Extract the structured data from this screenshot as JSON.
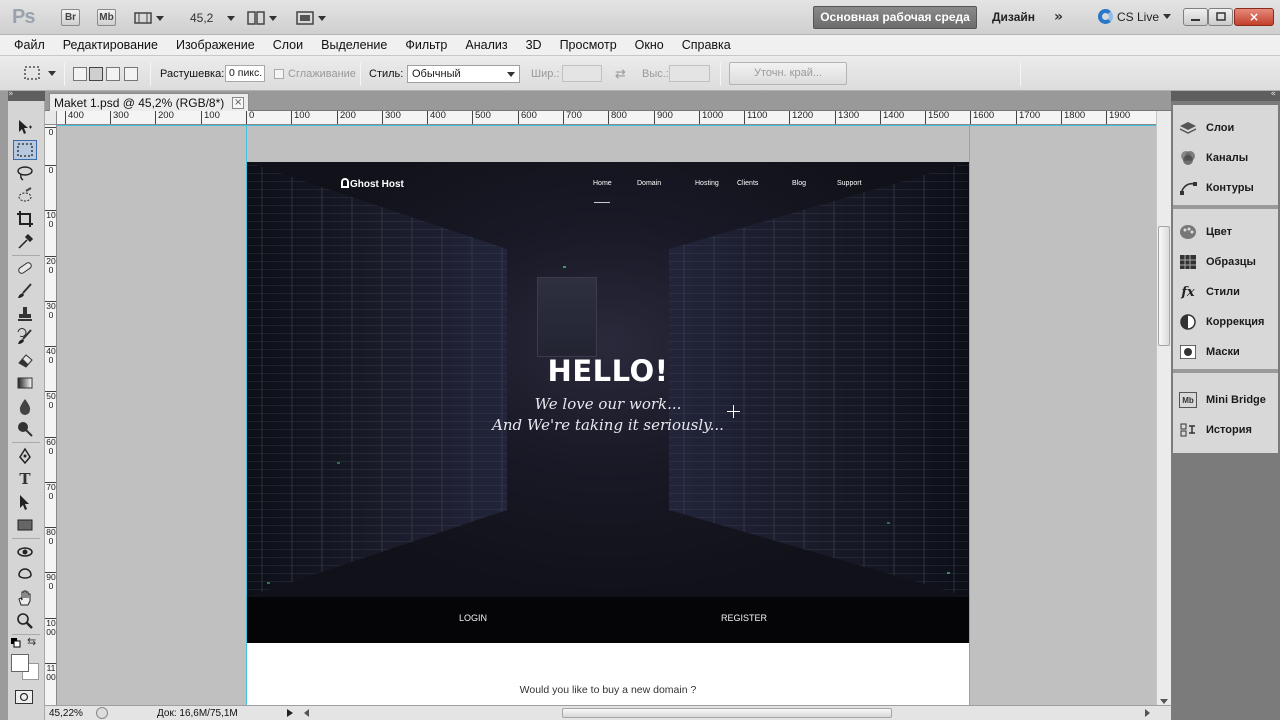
{
  "app": {
    "logo": "Ps",
    "bridge_btn": "Br",
    "minibridge_btn": "Mb",
    "zoom_value": "45,2",
    "workspace_active": "Основная рабочая среда",
    "workspace_design": "Дизайн",
    "more": "»",
    "cs_live": "CS Live"
  },
  "menu": [
    "Файл",
    "Редактирование",
    "Изображение",
    "Слои",
    "Выделение",
    "Фильтр",
    "Анализ",
    "3D",
    "Просмотр",
    "Окно",
    "Справка"
  ],
  "options": {
    "feather_label": "Растушевка:",
    "feather_value": "0 пикс.",
    "antialias_label": "Сглаживание",
    "style_label": "Стиль:",
    "style_value": "Обычный",
    "width_label": "Шир.:",
    "height_label": "Выс.:",
    "refine_label": "Уточн. край..."
  },
  "document": {
    "tab_title": "Maket 1.psd @ 45,2% (RGB/8*)",
    "close": "×",
    "ruler_top": [
      "400",
      "300",
      "200",
      "100",
      "0",
      "100",
      "200",
      "300",
      "400",
      "500",
      "600",
      "700",
      "800",
      "900",
      "1000",
      "1100",
      "1200",
      "1300",
      "1400",
      "1500",
      "1600",
      "1700",
      "1800",
      "1900"
    ],
    "ruler_left": [
      "0",
      "0",
      "100",
      "200",
      "300",
      "400",
      "500",
      "600",
      "700",
      "800",
      "900",
      "1000",
      "1100"
    ]
  },
  "mockup": {
    "brand": "Ghost Host",
    "nav": [
      "Home",
      "Domain",
      "Hosting",
      "Clients",
      "Blog",
      "Support"
    ],
    "hero_title": "HELLO!",
    "tagline_1": "We love our work...",
    "tagline_2": "And We're taking it seriously...",
    "login": "LOGIN",
    "register": "REGISTER",
    "domain_question": "Would you like to buy a new domain ?"
  },
  "status": {
    "zoom": "45,22%",
    "doc_info": "Док: 16,6M/75,1M"
  },
  "panels": {
    "group1": [
      "Слои",
      "Каналы",
      "Контуры"
    ],
    "group2": [
      "Цвет",
      "Образцы",
      "Стили",
      "Коррекция",
      "Маски"
    ],
    "group3": [
      "Mini Bridge",
      "История"
    ]
  },
  "colors": {
    "guide": "#42c4e0",
    "hero_bg": "#14141f",
    "auth_bar": "#050507"
  }
}
